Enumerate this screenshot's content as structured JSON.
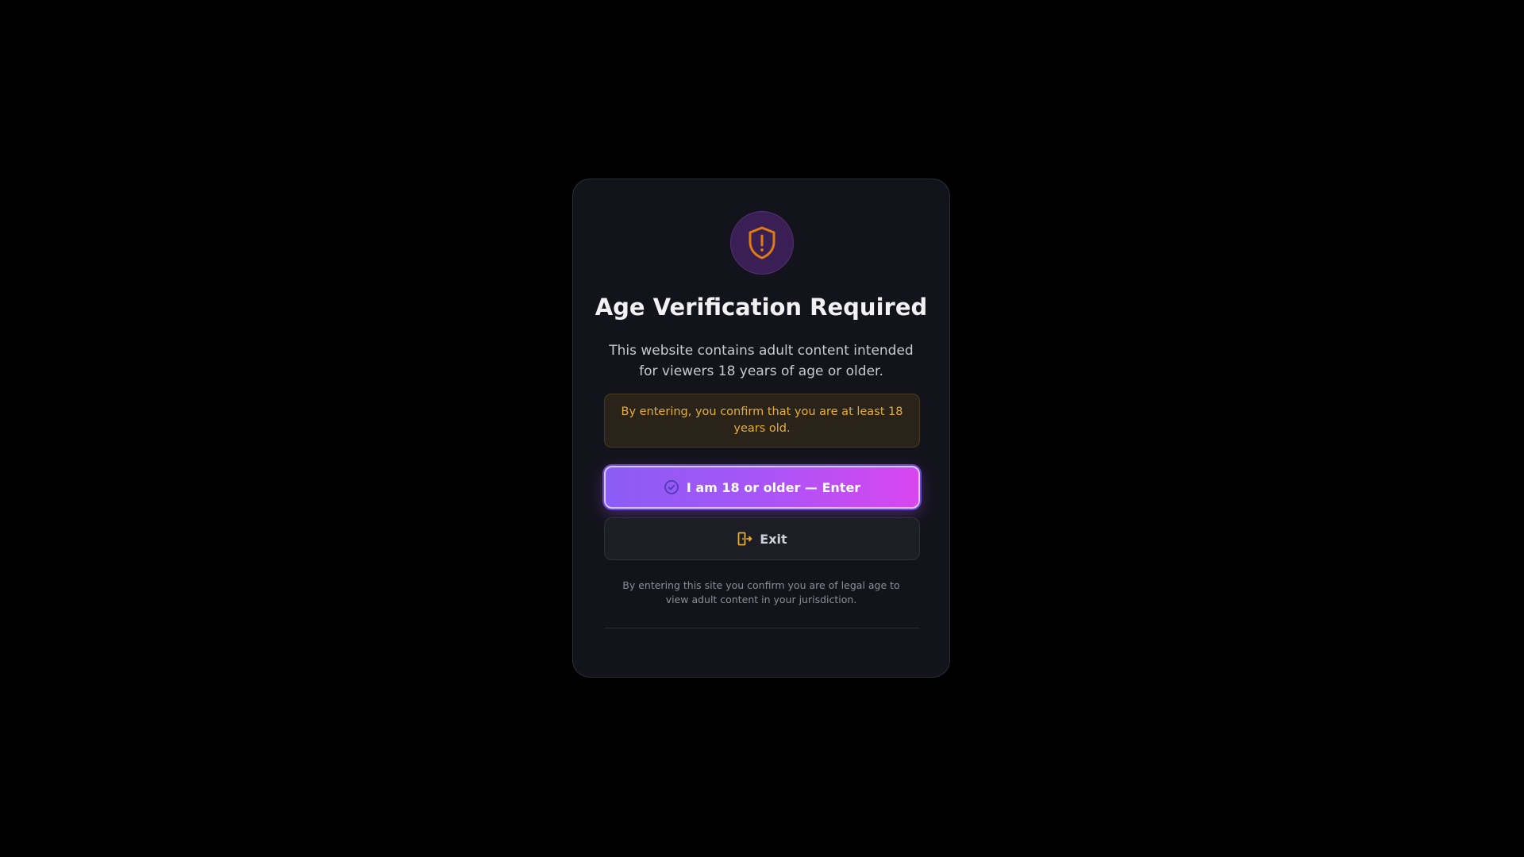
{
  "modal": {
    "title": "Age Verification Required",
    "description": "This website contains adult content intended for viewers 18 years of age or older.",
    "notice": "By entering, you confirm that you are at least 18 years old.",
    "enter_button": {
      "label": "I am 18 or older — Enter",
      "icon": "check-circle-icon"
    },
    "exit_button": {
      "label": "Exit",
      "icon": "door-exit-icon"
    },
    "legal_text": "By entering this site you confirm you are of legal age to view adult content in your jurisdiction.",
    "header_icon": "shield-alert-icon"
  },
  "colors": {
    "background": "#000000",
    "card": "#13131b",
    "accent_start": "#8b5cf6",
    "accent_end": "#d946ef",
    "warning": "#e7ae34",
    "shield": "#e07a12"
  }
}
